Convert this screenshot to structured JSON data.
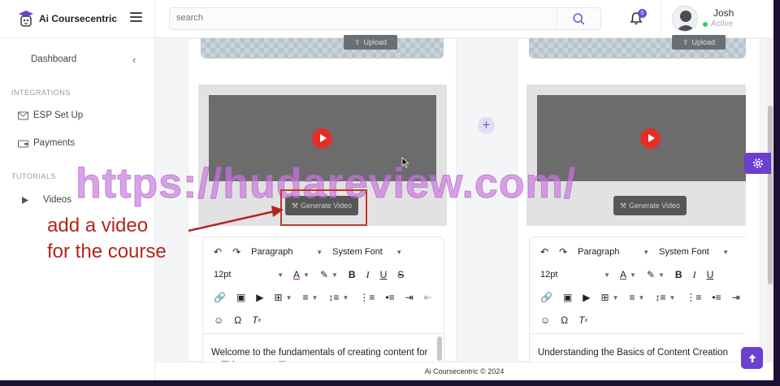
{
  "app": {
    "name": "Ai Coursecentric",
    "footer": "Ai Coursecentric © 2024"
  },
  "sidebar": {
    "dashboard": "Dashboard",
    "section_integrations": "INTEGRATIONS",
    "esp_setup": "ESP Set Up",
    "payments": "Payments",
    "section_tutorials": "TUTORIALS",
    "videos": "Videos"
  },
  "header": {
    "search_placeholder": "search",
    "notification_count": "0",
    "user_name": "Josh",
    "user_status": "Active"
  },
  "cards": [
    {
      "upload_label": "Upload",
      "generate_label": "Generate Video",
      "toolbar": {
        "block_format": "Paragraph",
        "font_family": "System Font",
        "font_size": "12pt"
      },
      "content": "Welcome to the fundamentals of creating content for ... This course will"
    },
    {
      "upload_label": "Upload",
      "generate_label": "Generate Video",
      "toolbar": {
        "block_format": "Paragraph",
        "font_family": "System Font",
        "font_size": "12pt"
      },
      "content": "Understanding the Basics of Content Creation"
    }
  ],
  "overlay": {
    "watermark": "https://hudareview.com/",
    "annotation_line1": "add a video",
    "annotation_line2": "for the course"
  },
  "colors": {
    "accent": "#6a3fd1",
    "play": "#e52d27",
    "annotation": "#b3261e"
  }
}
